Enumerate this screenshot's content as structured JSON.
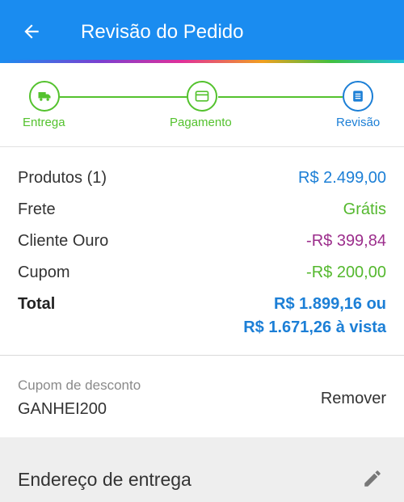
{
  "header": {
    "title": "Revisão do Pedido",
    "back_icon": "arrow-left-icon",
    "color": "#1a8cf0"
  },
  "steps": [
    {
      "label": "Entrega",
      "icon": "truck-icon",
      "state": "done"
    },
    {
      "label": "Pagamento",
      "icon": "credit-card-icon",
      "state": "done"
    },
    {
      "label": "Revisão",
      "icon": "list-icon",
      "state": "current"
    }
  ],
  "summary": {
    "rows": [
      {
        "label": "Produtos (1)",
        "value": "R$ 2.499,00"
      },
      {
        "label": "Frete",
        "value": "Grátis"
      },
      {
        "label": "Cliente Ouro",
        "value": "-R$ 399,84"
      },
      {
        "label": "Cupom",
        "value": "-R$ 200,00"
      }
    ],
    "total": {
      "label": "Total",
      "value": "R$ 1.899,16 ou",
      "value_cash": "R$ 1.671,26 à vista"
    }
  },
  "coupon": {
    "label": "Cupom de desconto",
    "code": "GANHEI200",
    "remove_label": "Remover"
  },
  "address": {
    "title": "Endereço de entrega",
    "edit_icon": "pencil-icon"
  },
  "colors": {
    "primary": "#1a8cf0",
    "success": "#54c22e",
    "accent_blue": "#1c7fd6",
    "purple": "#9c2e8c"
  }
}
